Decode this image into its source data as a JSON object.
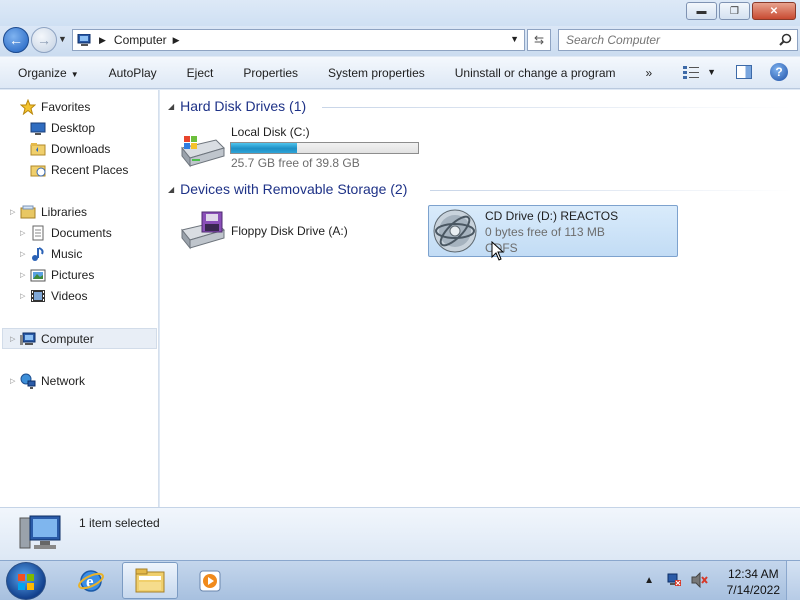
{
  "window": {
    "controls": [
      "minimize",
      "maximize",
      "close"
    ]
  },
  "address": {
    "crumbs": [
      "Computer"
    ],
    "search_placeholder": "Search Computer"
  },
  "toolbar": {
    "items": [
      "Organize",
      "AutoPlay",
      "Eject",
      "Properties",
      "System properties",
      "Uninstall or change a program"
    ],
    "more": "»"
  },
  "sidebar": {
    "favorites": "Favorites",
    "desktop": "Desktop",
    "downloads": "Downloads",
    "recent_places": "Recent Places",
    "libraries": "Libraries",
    "documents": "Documents",
    "music": "Music",
    "pictures": "Pictures",
    "videos": "Videos",
    "computer": "Computer",
    "network": "Network"
  },
  "groups": {
    "hdd_header": "Hard Disk Drives (1)",
    "removable_header": "Devices with Removable Storage (2)"
  },
  "drives": {
    "local": {
      "name": "Local Disk (C:)",
      "free": "25.7 GB free of 39.8 GB",
      "used_fraction": 0.354
    },
    "floppy": {
      "name": "Floppy Disk Drive (A:)"
    },
    "cd": {
      "name": "CD Drive (D:) REACTOS",
      "free": "0 bytes free of 113 MB",
      "fs": "CDFS"
    }
  },
  "details": {
    "status": "1 item selected"
  },
  "taskbar": {
    "time": "12:34 AM",
    "date": "7/14/2022"
  },
  "colors": {
    "group_header": "#1e3287",
    "usage_bar": "#1e8fc4",
    "selection": "#c2dcf5"
  }
}
